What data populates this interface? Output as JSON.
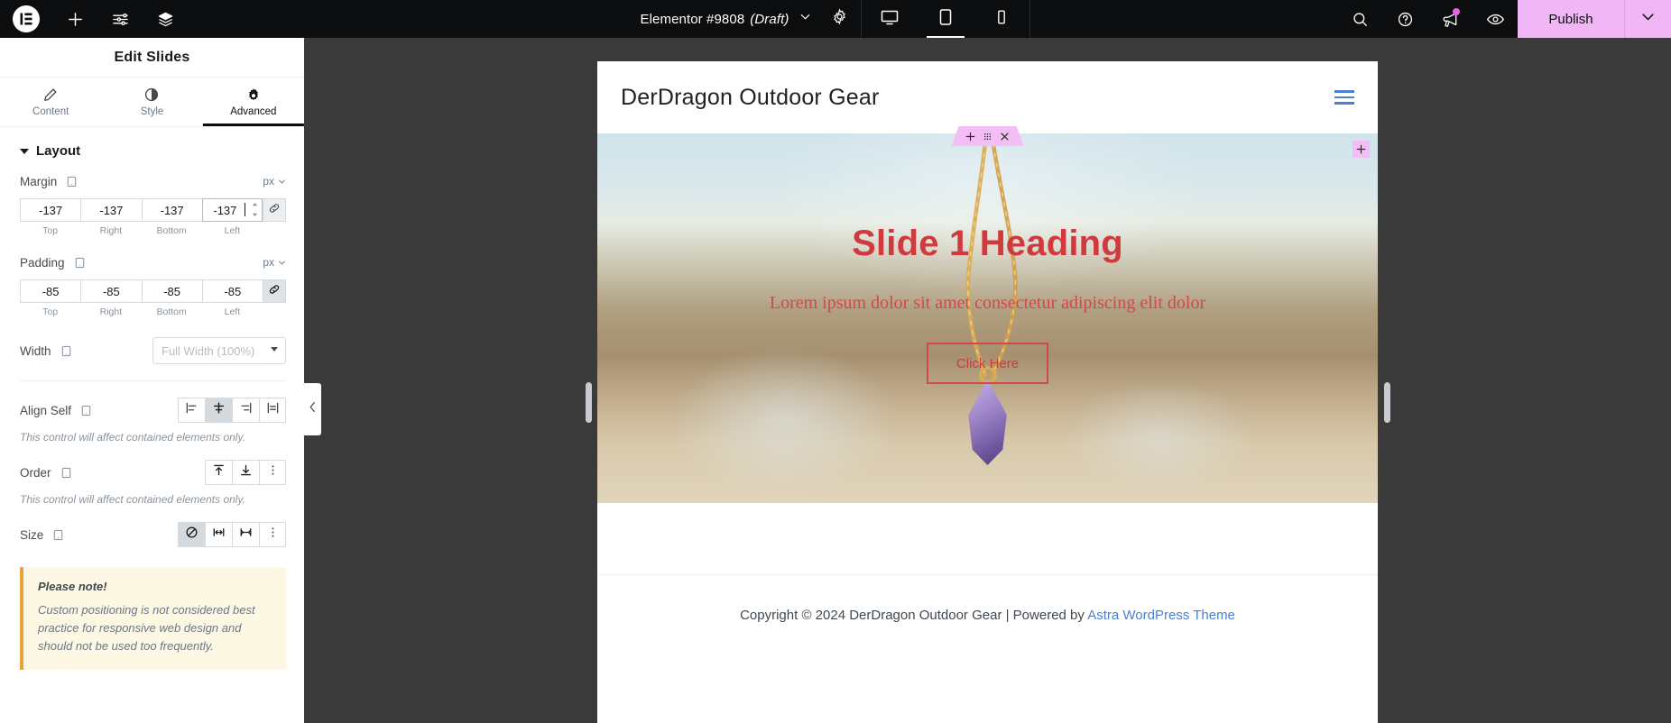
{
  "topbar": {
    "logo_icon": "elementor-logo-icon",
    "add_icon": "plus-icon",
    "settings_icon": "sliders-icon",
    "layers_icon": "layers-icon",
    "document_title": "Elementor #9808",
    "document_status": "(Draft)",
    "title_chevron_icon": "chevron-down-icon",
    "gear_icon": "gear-icon",
    "devices": [
      {
        "name": "desktop",
        "icon": "desktop-icon",
        "active": false
      },
      {
        "name": "tablet",
        "icon": "tablet-icon",
        "active": true
      },
      {
        "name": "mobile",
        "icon": "mobile-icon",
        "active": false
      }
    ],
    "search_icon": "search-icon",
    "help_icon": "question-circle-icon",
    "whats_new_icon": "megaphone-icon",
    "preview_icon": "eye-icon",
    "publish_label": "Publish",
    "publish_chevron_icon": "chevron-down-icon",
    "publish_bg": "#f0b6f5",
    "badge_color": "#e663e6"
  },
  "sidebar": {
    "panel_title": "Edit Slides",
    "tabs": [
      {
        "label": "Content",
        "icon": "pencil-icon",
        "active": false
      },
      {
        "label": "Style",
        "icon": "contrast-circle-icon",
        "active": false
      },
      {
        "label": "Advanced",
        "icon": "gear-icon",
        "active": true
      }
    ],
    "section": {
      "title": "Layout",
      "caret_icon": "caret-down-icon",
      "expanded": true
    },
    "margin": {
      "label": "Margin",
      "responsive_icon": "tablet-icon",
      "unit": "px",
      "unit_caret_icon": "chevron-down-icon",
      "values": [
        "-137",
        "-137",
        "-137",
        "-137"
      ],
      "sub_labels": [
        "Top",
        "Right",
        "Bottom",
        "Left"
      ],
      "focused_index": 3,
      "link_icon": "link-icon",
      "linked": false
    },
    "padding": {
      "label": "Padding",
      "responsive_icon": "tablet-icon",
      "unit": "px",
      "unit_caret_icon": "chevron-down-icon",
      "values": [
        "-85",
        "-85",
        "-85",
        "-85"
      ],
      "sub_labels": [
        "Top",
        "Right",
        "Bottom",
        "Left"
      ],
      "link_icon": "link-icon",
      "linked": true
    },
    "width": {
      "label": "Width",
      "responsive_icon": "tablet-icon",
      "value": "Full Width (100%)",
      "arrow_icon": "caret-down-icon"
    },
    "align_self": {
      "label": "Align Self",
      "responsive_icon": "tablet-icon",
      "options": [
        {
          "name": "start",
          "icon": "align-start-icon",
          "active": false
        },
        {
          "name": "center",
          "icon": "align-center-icon",
          "active": true
        },
        {
          "name": "end",
          "icon": "align-end-icon",
          "active": false
        },
        {
          "name": "stretch",
          "icon": "align-stretch-icon",
          "active": false
        }
      ],
      "hint": "This control will affect contained elements only."
    },
    "order": {
      "label": "Order",
      "responsive_icon": "tablet-icon",
      "options": [
        {
          "name": "start",
          "icon": "arrow-to-top-icon",
          "active": false
        },
        {
          "name": "end",
          "icon": "arrow-to-bottom-icon",
          "active": false
        },
        {
          "name": "custom",
          "icon": "ellipsis-vertical-icon",
          "active": false
        }
      ],
      "hint": "This control will affect contained elements only."
    },
    "size": {
      "label": "Size",
      "responsive_icon": "tablet-icon",
      "options": [
        {
          "name": "none",
          "icon": "no-entry-icon",
          "active": true
        },
        {
          "name": "grow",
          "icon": "expand-horizontal-icon",
          "active": false
        },
        {
          "name": "shrink",
          "icon": "shrink-horizontal-icon",
          "active": false
        },
        {
          "name": "custom",
          "icon": "ellipsis-vertical-icon",
          "active": false
        }
      ]
    },
    "notice": {
      "title": "Please note!",
      "body": "Custom positioning is not considered best practice for responsive web design and should not be used too frequently.",
      "accent": "#e8a33d",
      "bg": "#fcf8e3"
    },
    "collapse_icon": "chevron-left-icon"
  },
  "canvas": {
    "site_title": "DerDragon Outdoor Gear",
    "menu_icon": "hamburger-icon",
    "element_toolbar": {
      "add_icon": "plus-icon",
      "drag_icon": "drag-dots-icon",
      "close_icon": "close-icon",
      "bg": "#f3bdf5"
    },
    "add_section_icon": "plus-icon",
    "slide": {
      "heading": "Slide 1 Heading",
      "subheading": "Lorem ipsum dolor sit amet consectetur adipiscing elit dolor",
      "button_label": "Click Here",
      "text_color": "#cf3a3f"
    },
    "footer": {
      "text_before": "Copyright © 2024 DerDragon Outdoor Gear | Powered by ",
      "link_text": "Astra WordPress Theme",
      "link_color": "#4a7fd4"
    },
    "resize_handle_left": "resize-handle-left",
    "resize_handle_right": "resize-handle-right"
  }
}
